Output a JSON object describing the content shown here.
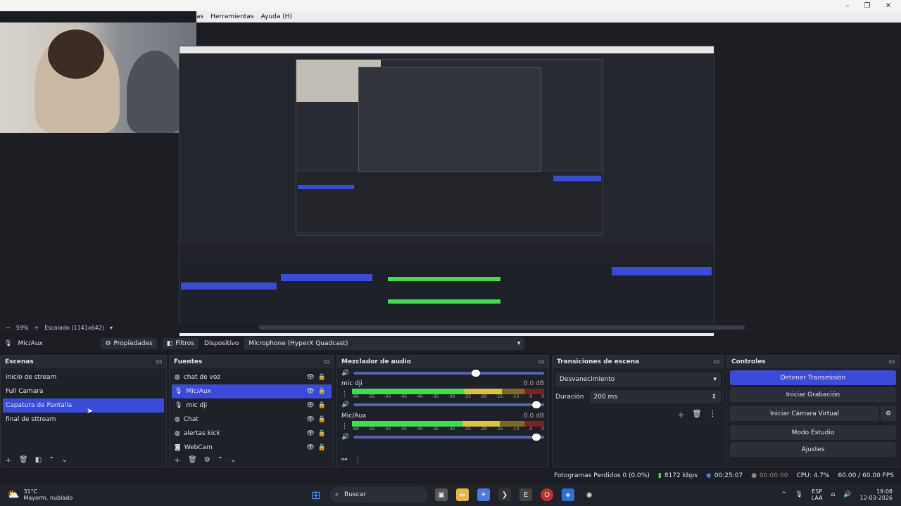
{
  "menu": {
    "items": [
      "as",
      "Herramientas",
      "Ayuda (H)"
    ]
  },
  "window": {
    "minimize": "–",
    "maximize": "❐",
    "close": "✕"
  },
  "preview": {
    "zoom_minus": "−",
    "zoom_value": "59%",
    "zoom_plus": "+",
    "scaled_label": "Escalado (1141x642)",
    "nested_caption": "Capatura de Pantalla"
  },
  "source_toolbar": {
    "source_name": "Mic/Aux",
    "properties_label": "Propiedades",
    "filters_label": "Filtros",
    "device_label": "Dispositivo",
    "device_value": "Microphone (HyperX Quadcast)"
  },
  "scenes": {
    "title": "Escenas",
    "items": [
      "inicio de stream",
      "Full Camara",
      "Capatura de Pantalla",
      "final de sttream"
    ],
    "selected_index": 2
  },
  "sources": {
    "title": "Fuentes",
    "items": [
      {
        "name": "chat de voz",
        "icon": "globe-icon"
      },
      {
        "name": "Mic/Aux",
        "icon": "microphone-icon"
      },
      {
        "name": "mic dji",
        "icon": "microphone-icon"
      },
      {
        "name": "Chat",
        "icon": "globe-icon"
      },
      {
        "name": "alertas kick",
        "icon": "globe-icon"
      },
      {
        "name": "WebCam",
        "icon": "camera-icon"
      }
    ],
    "selected_index": 1
  },
  "mixer": {
    "title": "Mezclador de audio",
    "ticks": [
      "-60",
      "-55",
      "-50",
      "-45",
      "-40",
      "-35",
      "-30",
      "-25",
      "-20",
      "-15",
      "-10",
      "-5",
      "0"
    ],
    "channels": [
      {
        "name": "mic dji",
        "db": "0.0 dB",
        "level": 0.78,
        "volume": 0.98
      },
      {
        "name": "Mic/Aux",
        "db": "0.0 dB",
        "level": 0.77,
        "volume": 0.98
      }
    ],
    "master_volume": 0.62
  },
  "transitions": {
    "title": "Transiciones de escena",
    "selected": "Desvanecimiento",
    "duration_label": "Duración",
    "duration_value": "200 ms"
  },
  "controls": {
    "title": "Controles",
    "stop_stream": "Detener Transmisión",
    "start_recording": "Iniciar Grabación",
    "start_virtual_cam": "Iniciar Cámara Virtual",
    "studio_mode": "Modo Estudio",
    "settings": "Ajustes"
  },
  "status": {
    "dropped_frames": "Fotogramas Perdidos 0 (0.0%)",
    "bitrate": "8172 kbps",
    "stream_time": "00:25:07",
    "rec_time": "00:00:00",
    "cpu": "CPU: 4.7%",
    "fps": "60.00 / 60.00 FPS"
  },
  "taskbar": {
    "weather_temp": "31°C",
    "weather_desc": "Mayorm. nublado",
    "search_placeholder": "Buscar",
    "lang_top": "ESP",
    "lang_bottom": "LAA",
    "time": "19:08",
    "date": "12-03-2026"
  },
  "colors": {
    "accent": "#3a4bdc",
    "bg": "#1a1c22",
    "panel": "#1f2128"
  }
}
